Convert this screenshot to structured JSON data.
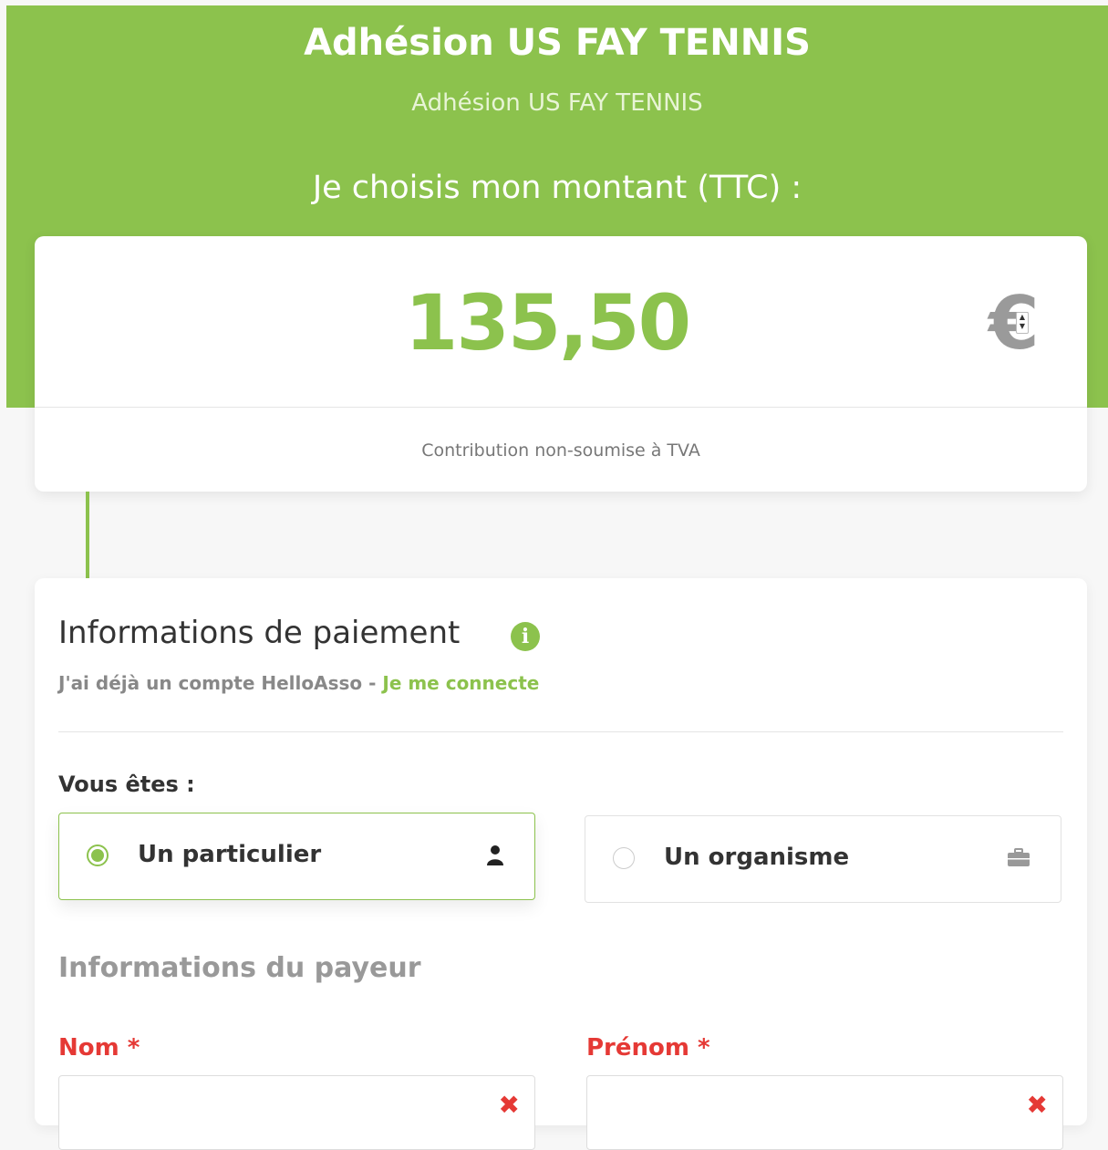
{
  "header": {
    "title": "Adhésion US FAY TENNIS",
    "subtitle": "Adhésion US FAY TENNIS",
    "choose_amount": "Je choisis mon montant (TTC) :"
  },
  "amount": {
    "value": "135,50",
    "currency": "€",
    "tva_note": "Contribution non-soumise à TVA"
  },
  "payment": {
    "title": "Informations de paiement",
    "account_prefix": "J'ai déjà un compte HelloAsso",
    "account_separator": " - ",
    "login_link": "Je me connecte",
    "vous_etes": "Vous êtes :",
    "options": [
      {
        "label": "Un particulier",
        "selected": true,
        "icon": "user-icon"
      },
      {
        "label": "Un organisme",
        "selected": false,
        "icon": "briefcase-icon"
      }
    ],
    "payer_title": "Informations du payeur",
    "fields": [
      {
        "label": "Nom *",
        "value": ""
      },
      {
        "label": "Prénom *",
        "value": ""
      }
    ]
  },
  "colors": {
    "accent": "#8cc24d",
    "error": "#e53935"
  }
}
